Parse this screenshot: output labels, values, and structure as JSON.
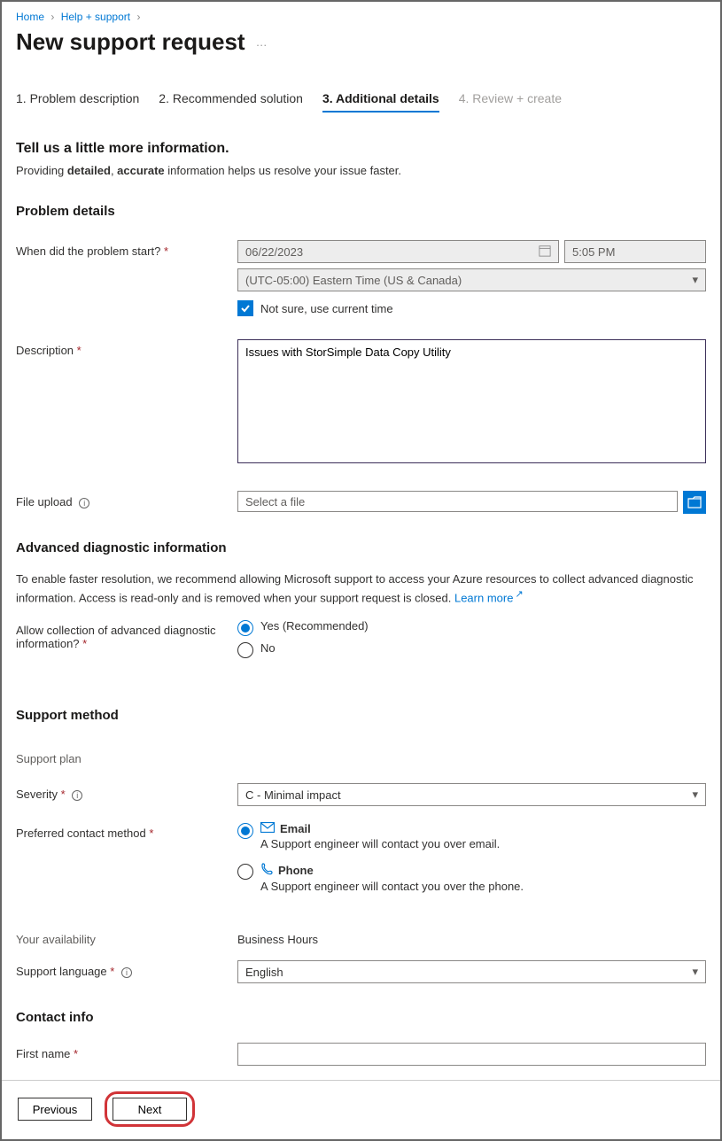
{
  "breadcrumb": {
    "home": "Home",
    "help": "Help + support"
  },
  "page_title": "New support request",
  "tabs": [
    {
      "label": "1. Problem description"
    },
    {
      "label": "2. Recommended solution"
    },
    {
      "label": "3. Additional details"
    },
    {
      "label": "4. Review + create"
    }
  ],
  "intro": {
    "heading": "Tell us a little more information.",
    "line_prefix": "Providing ",
    "b1": "detailed",
    "sep": ", ",
    "b2": "accurate",
    "line_suffix": " information helps us resolve your issue faster."
  },
  "problem_details": {
    "heading": "Problem details",
    "when_label": "When did the problem start?",
    "date": "06/22/2023",
    "time": "5:05 PM",
    "timezone": "(UTC-05:00) Eastern Time (US & Canada)",
    "not_sure": "Not sure, use current time",
    "description_label": "Description",
    "description_value": "Issues with StorSimple Data Copy Utility",
    "file_upload_label": "File upload",
    "file_placeholder": "Select a file"
  },
  "diag": {
    "heading": "Advanced diagnostic information",
    "body": "To enable faster resolution, we recommend allowing Microsoft support to access your Azure resources to collect advanced diagnostic information. Access is read-only and is removed when your support request is closed. ",
    "learn_more": "Learn more",
    "allow_label": "Allow collection of advanced diagnostic information?",
    "yes": "Yes (Recommended)",
    "no": "No"
  },
  "support": {
    "heading": "Support method",
    "plan_label": "Support plan",
    "severity_label": "Severity",
    "severity_value": "C - Minimal impact",
    "contact_label": "Preferred contact method",
    "email_label": "Email",
    "email_desc": "A Support engineer will contact you over email.",
    "phone_label": "Phone",
    "phone_desc": "A Support engineer will contact you over the phone.",
    "availability_label": "Your availability",
    "availability_value": "Business Hours",
    "language_label": "Support language",
    "language_value": "English"
  },
  "contact": {
    "heading": "Contact info",
    "first_name_label": "First name"
  },
  "footer": {
    "previous": "Previous",
    "next": "Next"
  }
}
